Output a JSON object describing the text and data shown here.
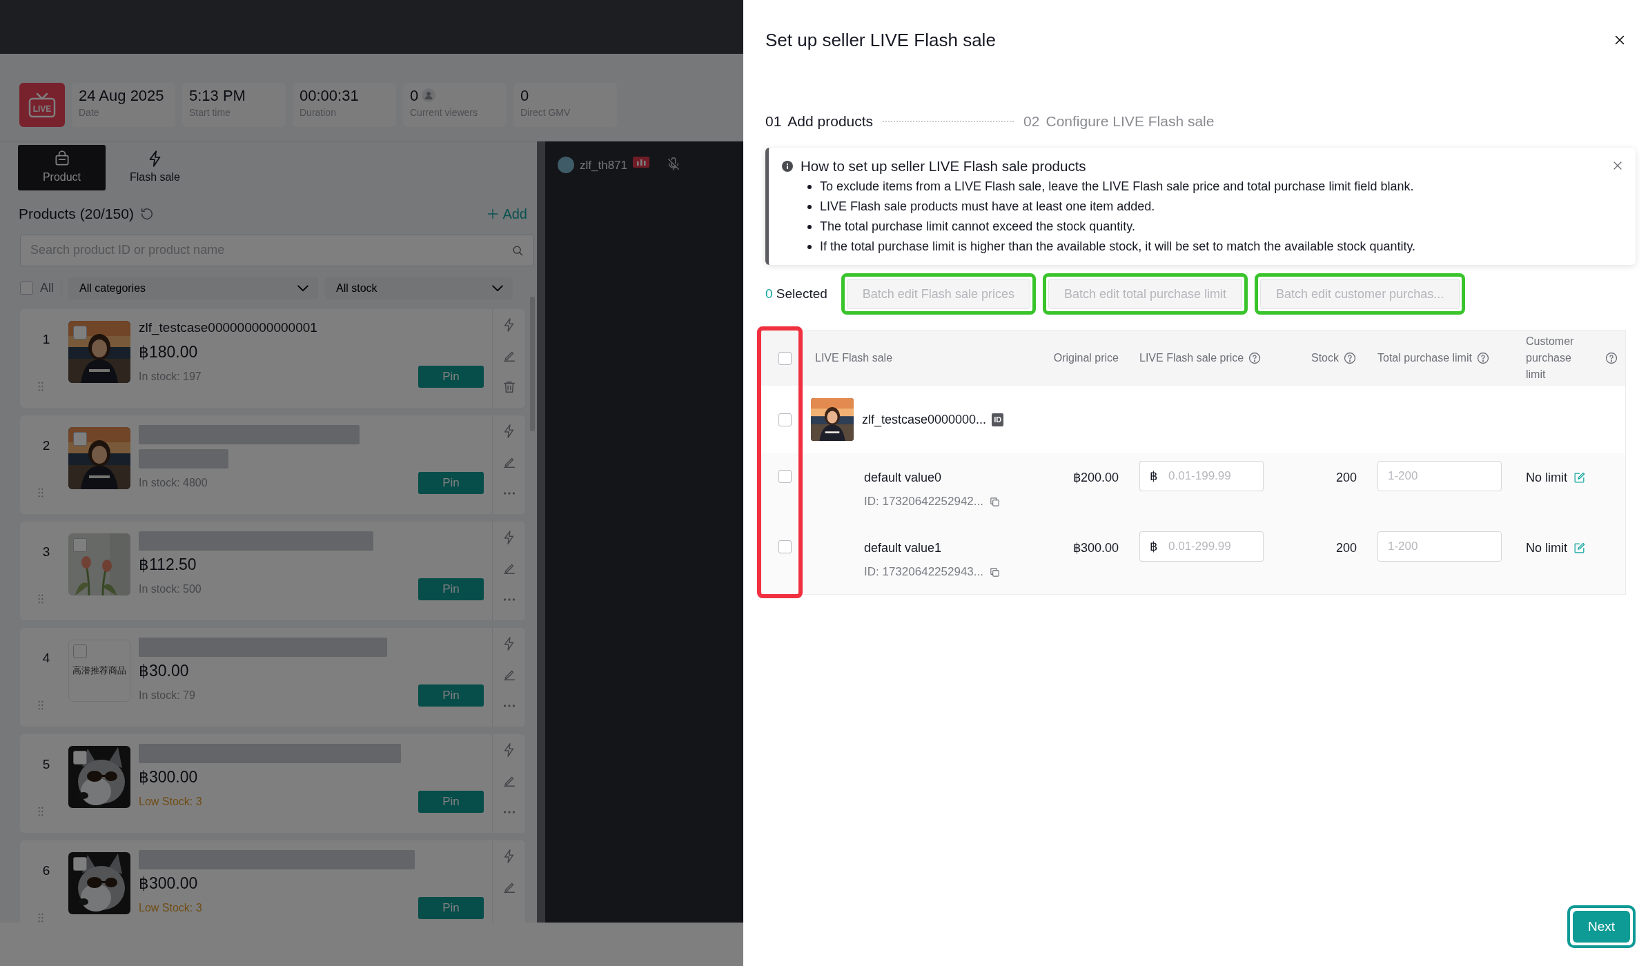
{
  "logo": "LIVE",
  "stats": [
    {
      "value": "24 Aug 2025",
      "label": "Date"
    },
    {
      "value": "5:13 PM",
      "label": "Start time"
    },
    {
      "value": "00:00:31",
      "label": "Duration"
    },
    {
      "value": "0",
      "label": "Current viewers"
    },
    {
      "value": "0",
      "label": "Direct GMV"
    }
  ],
  "side_tabs": [
    {
      "label": "Product",
      "selected": true
    },
    {
      "label": "Flash sale",
      "selected": false
    }
  ],
  "products": {
    "title": "Products (20/150)",
    "add": "Add",
    "search": {
      "placeholder": "Search product ID or product name"
    },
    "select_all": {
      "label": "All",
      "checked": false
    },
    "filters": [
      "All categories",
      "All stock"
    ],
    "items": [
      {
        "number": "1",
        "kind": "portrait",
        "checked": false,
        "name": "zlf_testcase000000000000001",
        "price": "฿180.00",
        "stock": "In stock: 197",
        "low_stock": false,
        "pin": "Pin"
      },
      {
        "number": "2",
        "kind": "portrait",
        "checked": false,
        "name_hidden": true,
        "price_hidden": true,
        "stock": "In stock: 4800",
        "low_stock": false,
        "pin": "Pin"
      },
      {
        "number": "3",
        "kind": "flowers",
        "checked": false,
        "name_hidden": true,
        "price": "฿112.50",
        "stock": "In stock: 500",
        "low_stock": false,
        "pin": "Pin"
      },
      {
        "number": "4",
        "kind": "placeholder",
        "caption": "高潜推荐商品",
        "checked": false,
        "name_hidden": true,
        "price": "฿30.00",
        "stock": "In stock: 79",
        "low_stock": false,
        "pin": "Pin"
      },
      {
        "number": "5",
        "kind": "dog",
        "checked": false,
        "name_hidden": true,
        "price": "฿300.00",
        "stock": "Low Stock: 3",
        "low_stock": true,
        "pin": "Pin"
      },
      {
        "number": "6",
        "kind": "dog",
        "checked": false,
        "name_hidden": true,
        "price": "฿300.00",
        "stock": "Low Stock: 3",
        "low_stock": true,
        "pin": "Pin"
      }
    ]
  },
  "stream": {
    "user": "zlf_th871",
    "muted": true
  },
  "drawer": {
    "title": "Set up seller LIVE Flash sale",
    "steps": [
      {
        "number": "01",
        "label": "Add products",
        "selected": true
      },
      {
        "number": "02",
        "label": "Configure LIVE Flash sale",
        "selected": false
      }
    ],
    "notice": {
      "title": "How to set up seller LIVE Flash sale products",
      "items": [
        "To exclude items from a LIVE Flash sale, leave the LIVE Flash sale price and total purchase limit field blank.",
        "LIVE Flash sale products must have at least one item added.",
        "The total purchase limit cannot exceed the stock quantity.",
        "If the total purchase limit is higher than the available stock, it will be set to match the available stock quantity."
      ]
    },
    "selection": {
      "count": "0",
      "label": "Selected"
    },
    "batch_buttons": [
      {
        "label": "Batch edit Flash sale prices",
        "disabled": true,
        "highlighted": true
      },
      {
        "label": "Batch edit total purchase limit",
        "disabled": true,
        "highlighted": true
      },
      {
        "label": "Batch edit customer purchas...",
        "disabled": true,
        "highlighted": true
      }
    ],
    "table": {
      "checkbox_column_highlighted": true,
      "select_all_checked": false,
      "columns": [
        {
          "label": "LIVE Flash sale",
          "help": false
        },
        {
          "label": "Original price",
          "help": false
        },
        {
          "label": "LIVE Flash sale price",
          "help": true
        },
        {
          "label": "Stock",
          "help": true
        },
        {
          "label": "Total purchase limit",
          "help": true
        },
        {
          "label": "Customer purchase limit",
          "help": true
        }
      ],
      "product": {
        "checked": false,
        "name": "zlf_testcase0000000...",
        "badge": "ID"
      },
      "variants": [
        {
          "checked": false,
          "name": "default value0",
          "id": "ID: 17320642252942...",
          "original_price": "฿200.00",
          "currency": "฿",
          "price_placeholder": "0.01-199.99",
          "stock": "200",
          "limit_placeholder": "1-200",
          "customer_limit": "No limit"
        },
        {
          "checked": false,
          "name": "default value1",
          "id": "ID: 17320642252943...",
          "original_price": "฿300.00",
          "currency": "฿",
          "price_placeholder": "0.01-299.99",
          "stock": "200",
          "limit_placeholder": "1-200",
          "customer_limit": "No limit"
        }
      ]
    },
    "next": {
      "label": "Next",
      "highlighted": true
    }
  }
}
